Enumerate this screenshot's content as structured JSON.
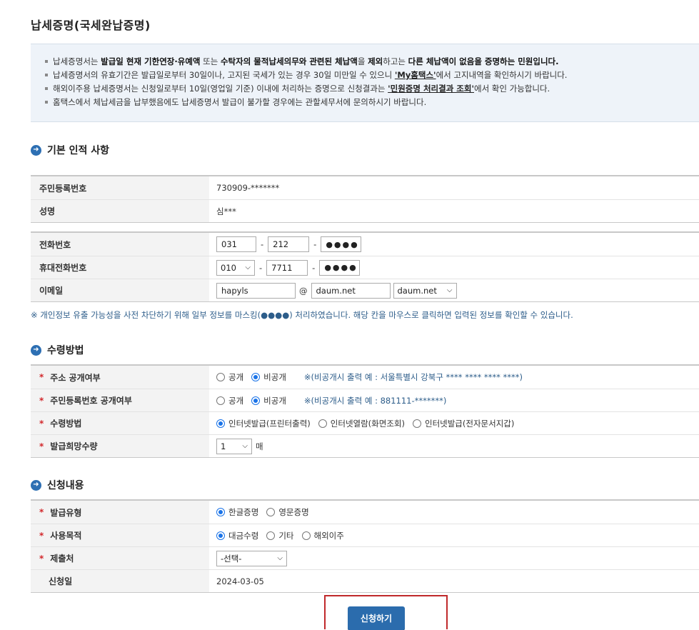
{
  "page": {
    "title": "납세증명(국세완납증명)"
  },
  "notice": {
    "line1": {
      "pre": "납세증명서는 ",
      "bold1": "발급일 현재 기한연장·유예액",
      "mid1": " 또는 ",
      "bold2": "수탁자의 물적납세의무와 관련된 체납액",
      "mid2": "을 ",
      "bold3": "제외",
      "mid3": "하고는 ",
      "bold4": "다른 체납액이 없음을 증명하는 민원입니다."
    },
    "line2": {
      "pre": "납세증명서의 유효기간은 발급일로부터 30일이나, 고지된 국세가 있는 경우 30일 미만일 수 있으니 ",
      "link": "'My홈택스'",
      "post": "에서 고지내역을 확인하시기 바랍니다."
    },
    "line3": {
      "pre": "해외이주용 납세증명서는 신청일로부터 10일(영업일 기준) 이내에 처리하는 증명으로 신청결과는 ",
      "link": "'민원증명 처리결과 조회'",
      "post": "에서 확인 가능합니다."
    },
    "line4": "홈택스에서 체납세금을 납부했음에도 납세증명서 발급이 불가할 경우에는 관할세무서에 문의하시기 바랍니다."
  },
  "basic": {
    "title": "기본 인적 사항",
    "rrn_label": "주민등록번호",
    "rrn_value": "730909-*******",
    "name_label": "성명",
    "name_value": "심***",
    "phone_label": "전화번호",
    "phone1": "031",
    "phone2": "212",
    "phone3": "●●●●",
    "mobile_label": "휴대전화번호",
    "mobile1": "010",
    "mobile2": "7711",
    "mobile3": "●●●●",
    "email_label": "이메일",
    "email_id": "hapyls",
    "email_at": "@",
    "email_domain": "daum.net",
    "email_select": "daum.net"
  },
  "mask_notice": "※ 개인정보 유출 가능성을 사전 차단하기 위해 일부 정보를 마스킹(●●●●) 처리하였습니다. 해당 칸을 마우스로 클릭하면 입력된 정보를 확인할 수 있습니다.",
  "receive": {
    "title": "수령방법",
    "required_mark": "*",
    "addr_label": "주소 공개여부",
    "addr_opt1": "공개",
    "addr_opt2": "비공개",
    "addr_hint": "※(비공개시 출력 예 : 서울특별시 강북구 **** **** **** ****)",
    "rrn_pub_label": "주민등록번호 공개여부",
    "rrn_opt1": "공개",
    "rrn_opt2": "비공개",
    "rrn_hint": "※(비공개시 출력 예 : 881111-*******)",
    "method_label": "수령방법",
    "method_opt1": "인터넷발급(프린터출력)",
    "method_opt2": "인터넷열람(화면조회)",
    "method_opt3": "인터넷발급(전자문서지갑)",
    "qty_label": "발급희망수량",
    "qty_value": "1",
    "qty_unit": "매"
  },
  "apply": {
    "title": "신청내용",
    "type_label": "발급유형",
    "type_opt1": "한글증명",
    "type_opt2": "영문증명",
    "purpose_label": "사용목적",
    "purpose_opt1": "대금수령",
    "purpose_opt2": "기타",
    "purpose_opt3": "해외이주",
    "submit_to_label": "제출처",
    "submit_to_value": "-선택-",
    "date_label": "신청일",
    "date_value": "2024-03-05"
  },
  "actions": {
    "submit_label": "신청하기"
  },
  "colors": {
    "accent": "#2b6cad",
    "required": "#d2272b",
    "highlight_border": "#c0292b",
    "hint": "#2d5d8a"
  }
}
